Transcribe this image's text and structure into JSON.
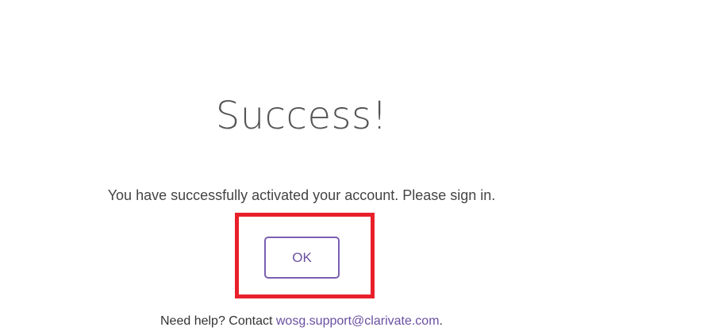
{
  "dialog": {
    "title": "Success!",
    "message": "You have successfully activated your account. Please sign in.",
    "ok_label": "OK",
    "help_text": "Need help? Contact ",
    "help_email": "wosg.support@clarivate.com",
    "help_suffix": "."
  },
  "colors": {
    "highlight": "#e8202a",
    "accent": "#6a4fa3"
  }
}
